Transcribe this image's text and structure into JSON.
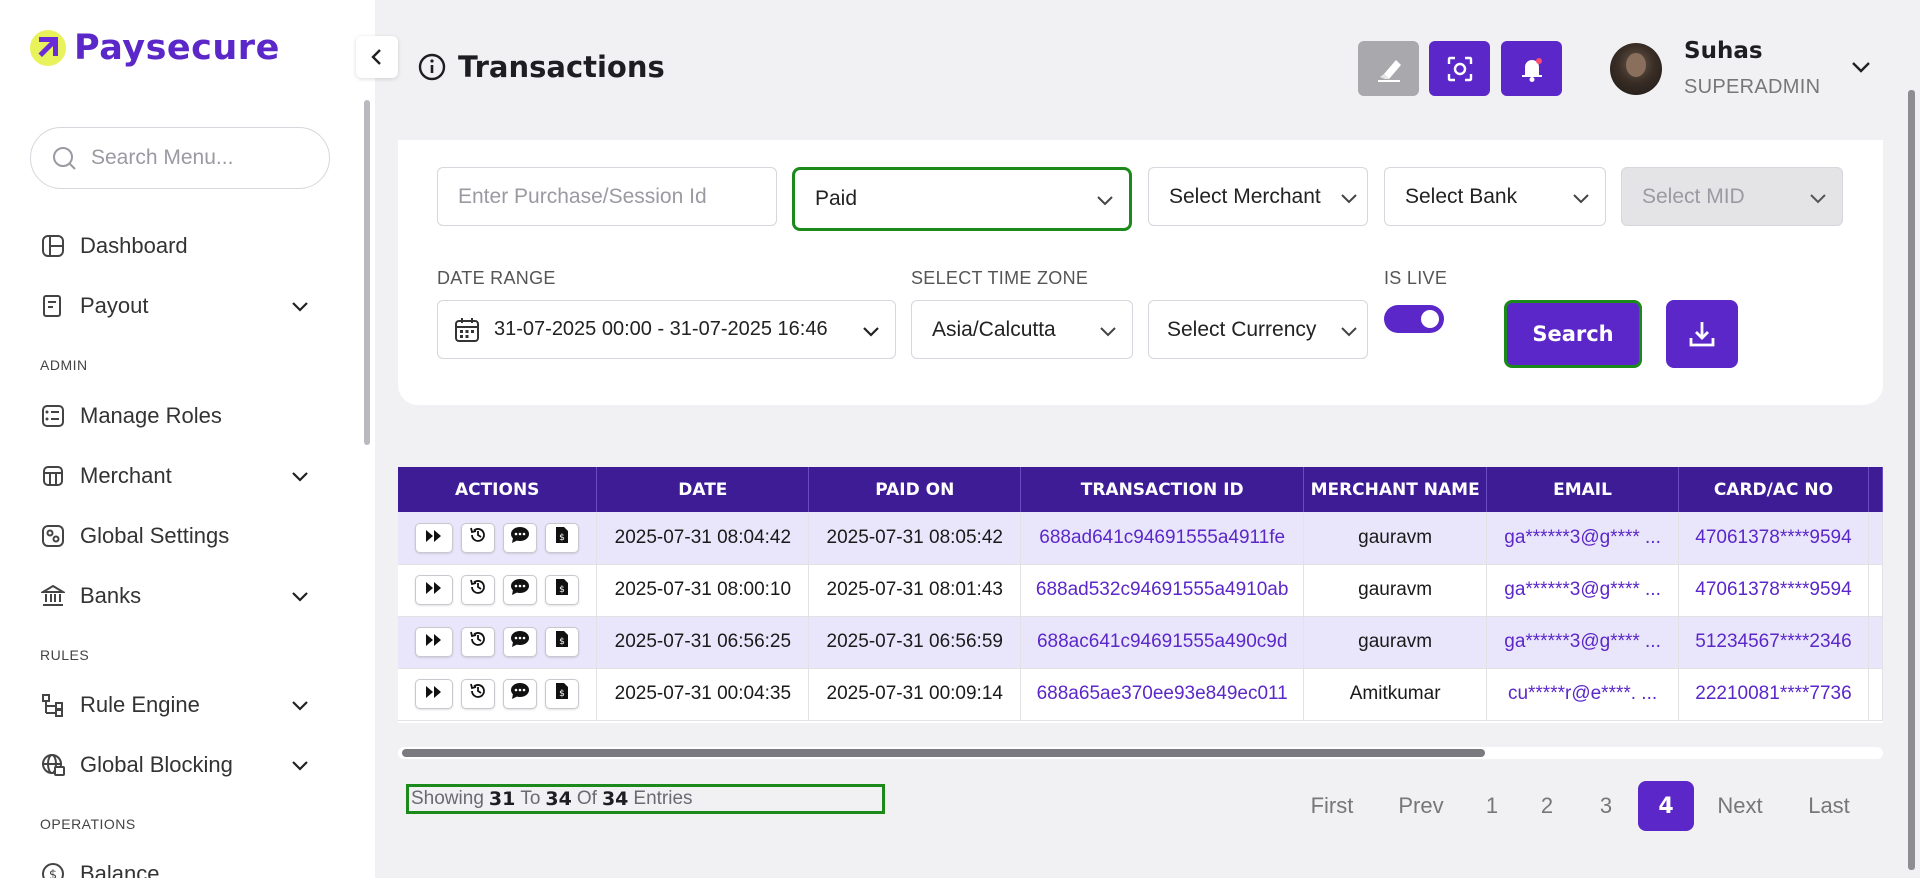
{
  "app": {
    "brand": "Paysecure",
    "brand_color": "#5b27c9",
    "success_outline": "#1b8a1b"
  },
  "sidebar": {
    "search_placeholder": "Search Menu...",
    "items": [
      {
        "label": "Dashboard",
        "icon": "dashboard-icon"
      },
      {
        "label": "Payout",
        "icon": "payout-icon",
        "expandable": true
      },
      {
        "label": "Manage Roles",
        "icon": "roles-icon"
      },
      {
        "label": "Merchant",
        "icon": "merchant-icon",
        "expandable": true
      },
      {
        "label": "Global Settings",
        "icon": "settings-icon"
      },
      {
        "label": "Banks",
        "icon": "bank-icon",
        "expandable": true
      },
      {
        "label": "Rule Engine",
        "icon": "rule-engine-icon",
        "expandable": true
      },
      {
        "label": "Global Blocking",
        "icon": "globe-block-icon",
        "expandable": true
      },
      {
        "label": "Balance",
        "icon": "balance-icon"
      }
    ],
    "sections": {
      "admin": "ADMIN",
      "rules": "RULES",
      "operations": "OPERATIONS"
    }
  },
  "header": {
    "title": "Transactions",
    "user_name": "Suhas",
    "user_role": "SUPERADMIN"
  },
  "filters": {
    "purchase_placeholder": "Enter Purchase/Session Id",
    "status_value": "Paid",
    "merchant_placeholder": "Select Merchant",
    "bank_placeholder": "Select Bank",
    "mid_placeholder": "Select MID",
    "date_range_label": "DATE RANGE",
    "date_range_value": "31-07-2025 00:00 - 31-07-2025 16:46",
    "timezone_label": "SELECT TIME ZONE",
    "timezone_value": "Asia/Calcutta",
    "currency_placeholder": "Select Currency",
    "is_live_label": "IS LIVE",
    "is_live": true,
    "search_label": "Search"
  },
  "table": {
    "columns": [
      "ACTIONS",
      "DATE",
      "PAID ON",
      "TRANSACTION ID",
      "MERCHANT NAME",
      "EMAIL",
      "CARD/AC NO"
    ],
    "rows": [
      {
        "date": "2025-07-31 08:04:42",
        "paid_on": "2025-07-31 08:05:42",
        "txn_id": "688ad641c94691555a4911fe",
        "merchant": "gauravm",
        "email": "ga******3@g**** ...",
        "card": "47061378****9594"
      },
      {
        "date": "2025-07-31 08:00:10",
        "paid_on": "2025-07-31 08:01:43",
        "txn_id": "688ad532c94691555a4910ab",
        "merchant": "gauravm",
        "email": "ga******3@g**** ...",
        "card": "47061378****9594"
      },
      {
        "date": "2025-07-31 06:56:25",
        "paid_on": "2025-07-31 06:56:59",
        "txn_id": "688ac641c94691555a490c9d",
        "merchant": "gauravm",
        "email": "ga******3@g**** ...",
        "card": "51234567****2346"
      },
      {
        "date": "2025-07-31 00:04:35",
        "paid_on": "2025-07-31 00:09:14",
        "txn_id": "688a65ae370ee93e849ec011",
        "merchant": "Amitkumar",
        "email": "cu*****r@e****. ...",
        "card": "22210081****7736"
      }
    ]
  },
  "footer": {
    "showing_word": "Showing",
    "from": "31",
    "to_word": "To",
    "to": "34",
    "of_word": "Of",
    "total": "34",
    "entries_word": "Entries"
  },
  "pagination": {
    "first": "First",
    "prev": "Prev",
    "pages": [
      "1",
      "2",
      "3",
      "4"
    ],
    "current": "4",
    "next": "Next",
    "last": "Last"
  }
}
